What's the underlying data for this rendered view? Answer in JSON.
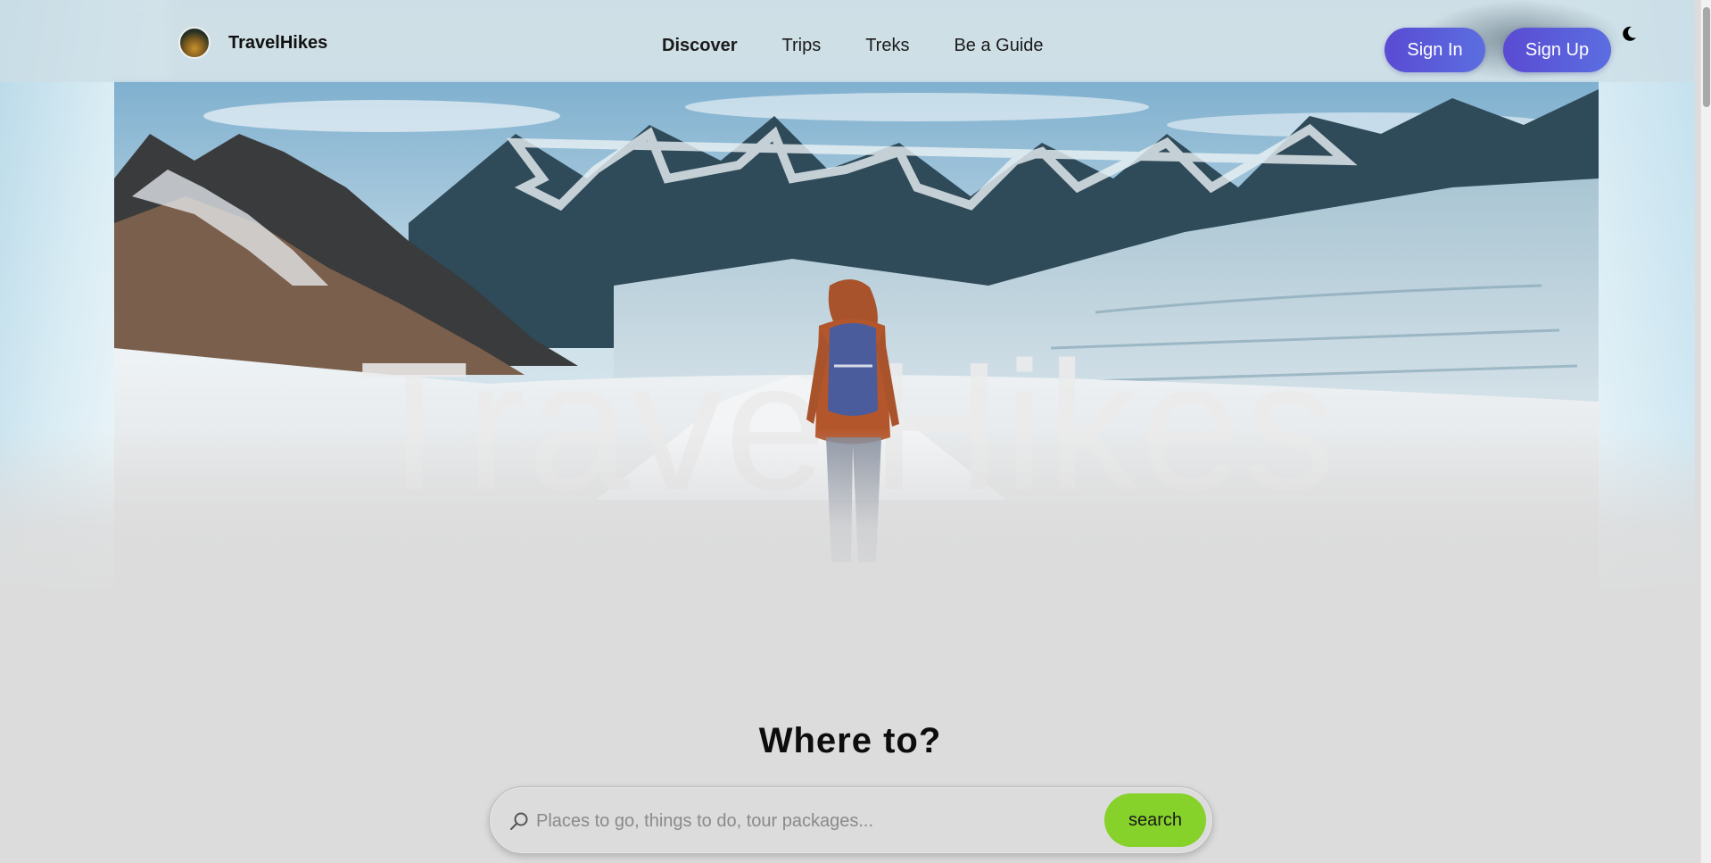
{
  "brand": {
    "name": "TravelHikes"
  },
  "nav": {
    "links": [
      {
        "label": "Discover",
        "active": true
      },
      {
        "label": "Trips"
      },
      {
        "label": "Treks"
      },
      {
        "label": "Be a Guide"
      }
    ],
    "sign_in": "Sign In",
    "sign_up": "Sign Up",
    "theme_icon": "moon-icon"
  },
  "hero": {
    "title": "TravelHikes"
  },
  "search": {
    "heading": "Where to?",
    "placeholder": "Places to go, things to do, tour packages...",
    "button": "search",
    "icon": "search-icon"
  },
  "colors": {
    "accent_button": "#5a4bd3",
    "search_button": "#86d12a",
    "background": "#dcdcdc"
  }
}
